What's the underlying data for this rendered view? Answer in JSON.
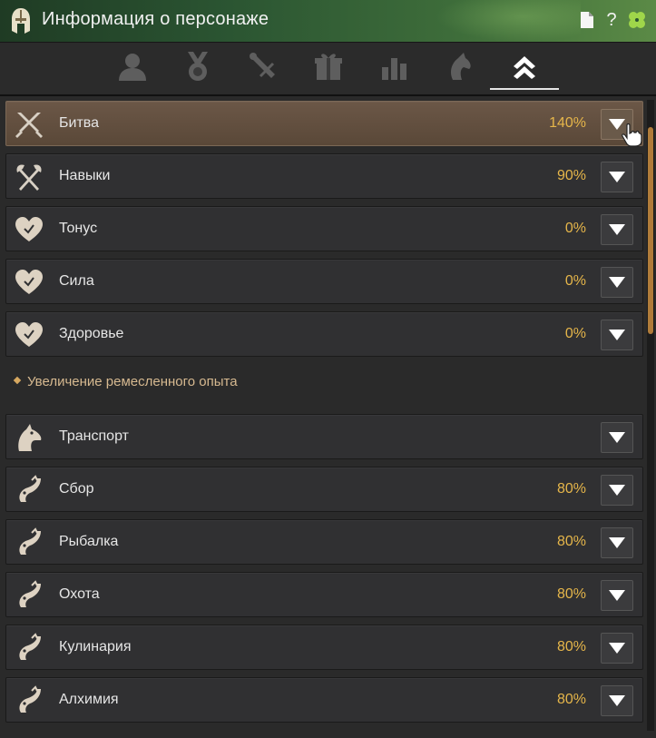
{
  "window": {
    "title": "Информация о персонаже"
  },
  "titlebar_buttons": [
    "page-icon",
    "help-icon",
    "clover-icon"
  ],
  "titlebar_help_glyph": "?",
  "tabs": [
    {
      "icon": "person-icon",
      "active": false
    },
    {
      "icon": "medal-icon",
      "active": false
    },
    {
      "icon": "scroll-icon",
      "active": false
    },
    {
      "icon": "gift-icon",
      "active": false
    },
    {
      "icon": "stats-bars-icon",
      "active": false
    },
    {
      "icon": "horse-head-icon",
      "active": false
    },
    {
      "icon": "double-chevron-up-icon",
      "active": true
    }
  ],
  "combat_rows": [
    {
      "label": "Битва",
      "value": "140%",
      "icon": "crossed-swords-icon",
      "active": true
    },
    {
      "label": "Навыки",
      "value": "90%",
      "icon": "crossed-axes-icon",
      "active": false
    },
    {
      "label": "Тонус",
      "value": "0%",
      "icon": "heart-icon",
      "active": false
    },
    {
      "label": "Сила",
      "value": "0%",
      "icon": "heart-icon",
      "active": false
    },
    {
      "label": "Здоровье",
      "value": "0%",
      "icon": "heart-icon",
      "active": false
    }
  ],
  "section_title": "Увеличение ремесленного опыта",
  "craft_rows": [
    {
      "label": "Транспорт",
      "value": "",
      "icon": "horse-icon"
    },
    {
      "label": "Сбор",
      "value": "80%",
      "icon": "fish-hook-icon"
    },
    {
      "label": "Рыбалка",
      "value": "80%",
      "icon": "fish-hook-icon"
    },
    {
      "label": "Охота",
      "value": "80%",
      "icon": "fish-hook-icon"
    },
    {
      "label": "Кулинария",
      "value": "80%",
      "icon": "fish-hook-icon"
    },
    {
      "label": "Алхимия",
      "value": "80%",
      "icon": "fish-hook-icon"
    }
  ],
  "colors": {
    "accent_value": "#e6b64a",
    "active_row": "#6b5747",
    "titlebar_green": "#2b5532",
    "scroll_thumb": "#b07c3a"
  }
}
